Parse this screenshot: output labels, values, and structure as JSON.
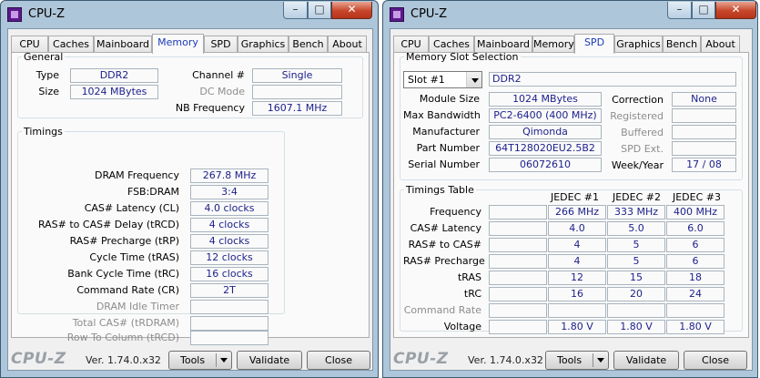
{
  "window": {
    "title": "CPU-Z",
    "buttons": {
      "minimize": "–",
      "maximize": "□",
      "close": "✕"
    }
  },
  "tabs": [
    "CPU",
    "Caches",
    "Mainboard",
    "Memory",
    "SPD",
    "Graphics",
    "Bench",
    "About"
  ],
  "footer": {
    "brand": "CPU-Z",
    "version": "Ver. 1.74.0.x32",
    "tools": "Tools",
    "validate": "Validate",
    "close": "Close"
  },
  "memory": {
    "general": {
      "legend": "General",
      "type_label": "Type",
      "type_value": "DDR2",
      "size_label": "Size",
      "size_value": "1024 MBytes",
      "channel_label": "Channel #",
      "channel_value": "Single",
      "dc_mode_label": "DC Mode",
      "dc_mode_value": "",
      "nb_freq_label": "NB Frequency",
      "nb_freq_value": "1607.1 MHz"
    },
    "timings": {
      "legend": "Timings",
      "rows": [
        {
          "label": "DRAM Frequency",
          "value": "267.8 MHz",
          "enabled": true
        },
        {
          "label": "FSB:DRAM",
          "value": "3:4",
          "enabled": true
        },
        {
          "label": "CAS# Latency (CL)",
          "value": "4.0 clocks",
          "enabled": true
        },
        {
          "label": "RAS# to CAS# Delay (tRCD)",
          "value": "4 clocks",
          "enabled": true
        },
        {
          "label": "RAS# Precharge (tRP)",
          "value": "4 clocks",
          "enabled": true
        },
        {
          "label": "Cycle Time (tRAS)",
          "value": "12 clocks",
          "enabled": true
        },
        {
          "label": "Bank Cycle Time (tRC)",
          "value": "16 clocks",
          "enabled": true
        },
        {
          "label": "Command Rate (CR)",
          "value": "2T",
          "enabled": true
        },
        {
          "label": "DRAM Idle Timer",
          "value": "",
          "enabled": false
        },
        {
          "label": "Total CAS# (tRDRAM)",
          "value": "",
          "enabled": false
        },
        {
          "label": "Row To Column (tRCD)",
          "value": "",
          "enabled": false
        }
      ]
    }
  },
  "spd": {
    "slot_selection": {
      "legend": "Memory Slot Selection",
      "slot": "Slot #1",
      "type": "DDR2"
    },
    "left_rows": [
      {
        "label": "Module Size",
        "value": "1024 MBytes"
      },
      {
        "label": "Max Bandwidth",
        "value": "PC2-6400 (400 MHz)"
      },
      {
        "label": "Manufacturer",
        "value": "Qimonda"
      },
      {
        "label": "Part Number",
        "value": "64T128020EU2.5B2"
      },
      {
        "label": "Serial Number",
        "value": "06072610"
      }
    ],
    "right_rows": [
      {
        "label": "Correction",
        "value": "None",
        "enabled": true
      },
      {
        "label": "Registered",
        "value": "",
        "enabled": false
      },
      {
        "label": "Buffered",
        "value": "",
        "enabled": false
      },
      {
        "label": "SPD Ext.",
        "value": "",
        "enabled": false
      },
      {
        "label": "Week/Year",
        "value": "17 / 08",
        "enabled": true
      }
    ],
    "timings_table": {
      "legend": "Timings Table",
      "headers": [
        "JEDEC #1",
        "JEDEC #2",
        "JEDEC #3"
      ],
      "rows": [
        {
          "label": "Frequency",
          "values": [
            "266 MHz",
            "333 MHz",
            "400 MHz"
          ],
          "enabled": true
        },
        {
          "label": "CAS# Latency",
          "values": [
            "4.0",
            "5.0",
            "6.0"
          ],
          "enabled": true
        },
        {
          "label": "RAS# to CAS#",
          "values": [
            "4",
            "5",
            "6"
          ],
          "enabled": true
        },
        {
          "label": "RAS# Precharge",
          "values": [
            "4",
            "5",
            "6"
          ],
          "enabled": true
        },
        {
          "label": "tRAS",
          "values": [
            "12",
            "15",
            "18"
          ],
          "enabled": true
        },
        {
          "label": "tRC",
          "values": [
            "16",
            "20",
            "24"
          ],
          "enabled": true
        },
        {
          "label": "Command Rate",
          "values": [
            "",
            "",
            ""
          ],
          "enabled": false
        },
        {
          "label": "Voltage",
          "values": [
            "1.80 V",
            "1.80 V",
            "1.80 V"
          ],
          "enabled": true
        }
      ]
    }
  }
}
